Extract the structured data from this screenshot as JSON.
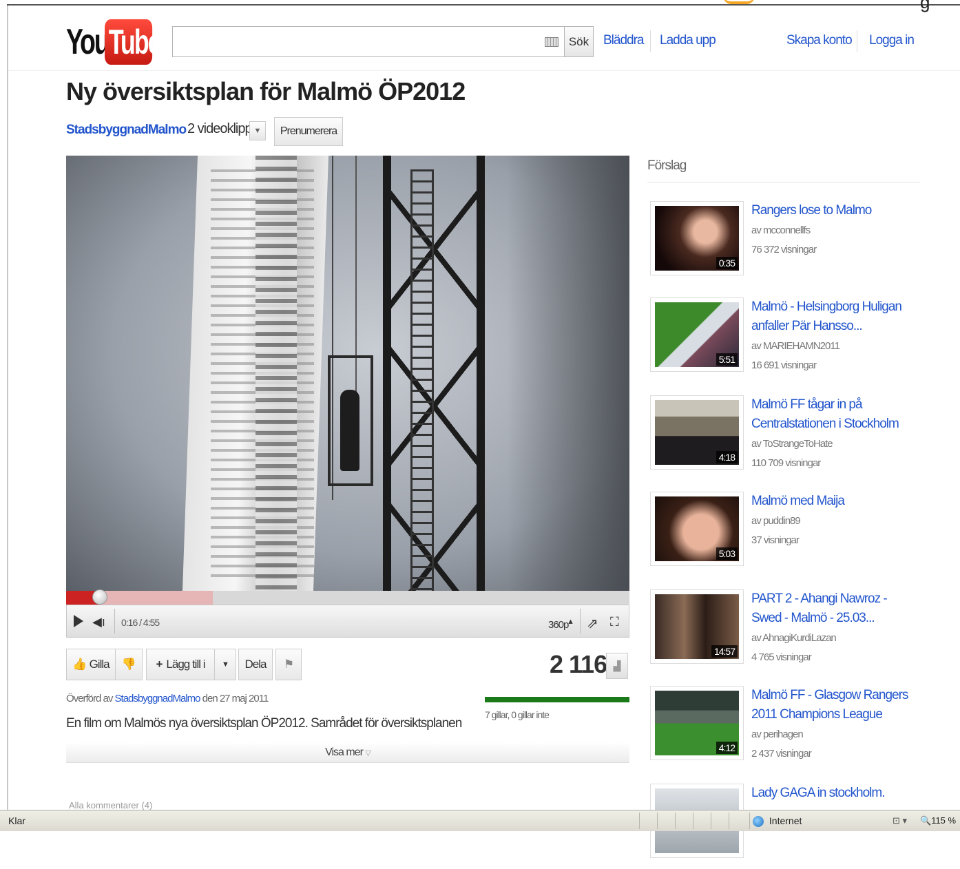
{
  "header": {
    "logo_you": "You",
    "logo_tube": "Tube",
    "search_placeholder": "",
    "search_button": "Sök",
    "nav": [
      "Bläddra",
      "Ladda upp"
    ],
    "account": [
      "Skapa konto",
      "Logga in"
    ]
  },
  "video": {
    "title": "Ny översiktsplan för Malmö ÖP2012",
    "channel": "StadsbyggnadMalmo",
    "channel_video_count": "2 videoklipp",
    "subscribe_label": "Prenumerera",
    "time": "0:16 / 4:55",
    "quality": "360p",
    "played_fraction": 0.06,
    "buffered_fraction": 0.26
  },
  "actions": {
    "like_label": "Gilla",
    "add_to_label": "Lägg till i",
    "share_label": "Dela",
    "view_count": "2 116"
  },
  "info": {
    "uploaded_prefix": "Överförd av",
    "uploader": "StadsbyggnadMalmo",
    "uploaded_suffix": "den 27 maj 2011",
    "description": "En film om Malmös nya översiktsplan ÖP2012. Samrådet för översiktsplanen",
    "likes_text": "7 gillar, 0 gillar inte",
    "like_ratio": 1.0,
    "show_more": "Visa mer"
  },
  "comments_cut": "Alla kommentarer (4)",
  "sidebar": {
    "heading": "Förslag",
    "items": [
      {
        "title": "Rangers lose to Malmo",
        "by": "av mcconnellfs",
        "views": "76 372 visningar",
        "duration": "0:35"
      },
      {
        "title": "Malmö - Helsingborg Huligan anfaller Pär Hansso...",
        "by": "av MARIEHAMN2011",
        "views": "16 691 visningar",
        "duration": "5:51"
      },
      {
        "title": "Malmö FF tågar in på Centralstationen i Stockholm",
        "by": "av ToStrangeToHate",
        "views": "110 709 visningar",
        "duration": "4:18"
      },
      {
        "title": "Malmö med Maija",
        "by": "av puddin89",
        "views": "37 visningar",
        "duration": "5:03"
      },
      {
        "title": "PART 2 - Ahangi Nawroz - Swed - Malmö - 25.03...",
        "by": "av AhnagiKurdiLazan",
        "views": "4 765 visningar",
        "duration": "14:57"
      },
      {
        "title": "Malmö FF - Glasgow Rangers 2011 Champions League",
        "by": "av perihagen",
        "views": "2 437 visningar",
        "duration": "4:12"
      },
      {
        "title": "Lady GAGA in stockholm.",
        "by": "",
        "views": "",
        "duration": ""
      }
    ]
  },
  "statusbar": {
    "left": "Klar",
    "zone": "Internet",
    "zoom": "115 %"
  },
  "colors": {
    "link": "#2255cc",
    "progress": "#cc2222",
    "likes": "#1a7a1a",
    "logo_red": "#e62117"
  }
}
